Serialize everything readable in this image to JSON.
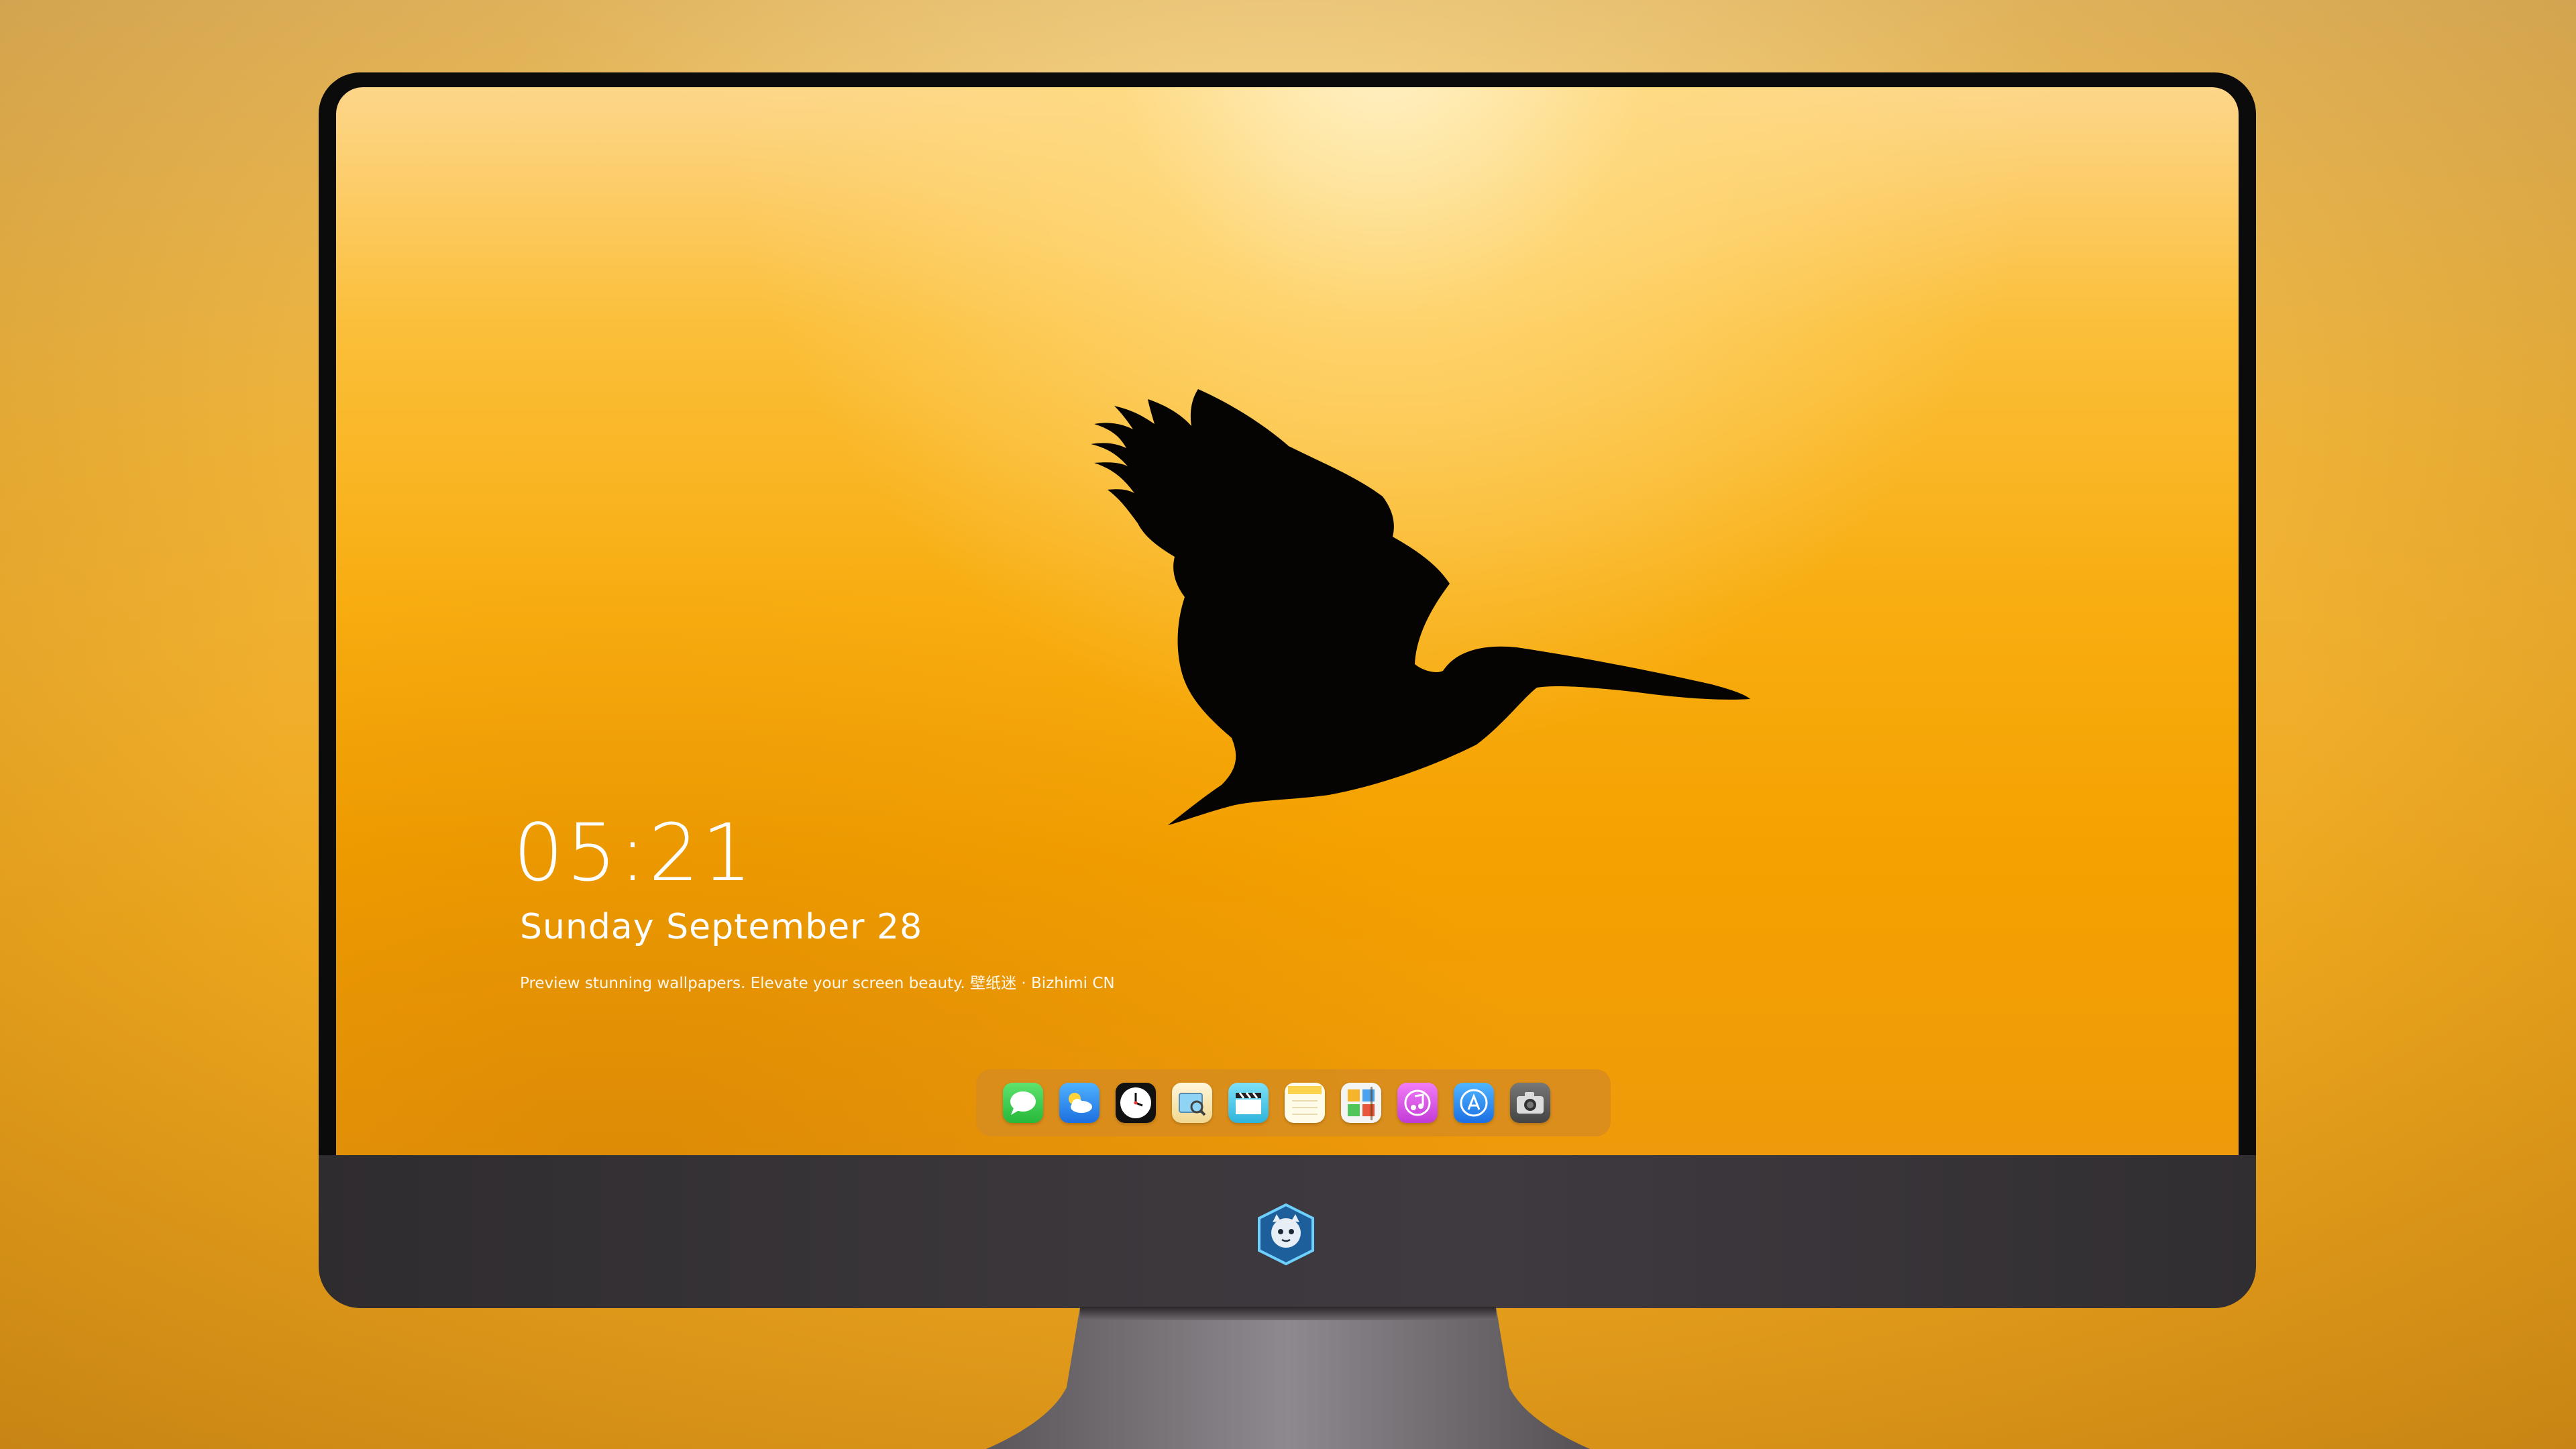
{
  "lockscreen": {
    "time": "05:21",
    "date": "Sunday September  28",
    "tagline": "Preview stunning wallpapers. Elevate your screen beauty. 壁纸迷 · Bizhimi CN"
  },
  "dock": {
    "apps": [
      {
        "name": "Messages",
        "icon": "messages-icon",
        "color": "#33c94a"
      },
      {
        "name": "Weather",
        "icon": "weather-icon",
        "color": "#2a8ef0"
      },
      {
        "name": "Clock",
        "icon": "clock-icon",
        "color": "#111111"
      },
      {
        "name": "Preview",
        "icon": "preview-icon",
        "color": "#f3e7c4"
      },
      {
        "name": "Clips",
        "icon": "clapperboard-icon",
        "color": "#53c8e6"
      },
      {
        "name": "Notes",
        "icon": "notes-icon",
        "color": "#fff6d8"
      },
      {
        "name": "Photo Booth",
        "icon": "photo-collage-icon",
        "color": "#f2f2f2"
      },
      {
        "name": "Music",
        "icon": "music-note-icon",
        "color": "#e04ee8"
      },
      {
        "name": "App Store",
        "icon": "app-store-icon",
        "color": "#2f8df5"
      },
      {
        "name": "Camera",
        "icon": "camera-icon",
        "color": "#555555"
      }
    ]
  },
  "colors": {
    "wallpaper_top": "#fdd68a",
    "wallpaper_bottom": "#ee9a0a",
    "bezel": "#0b0b0b",
    "chin": "#3b373b"
  }
}
